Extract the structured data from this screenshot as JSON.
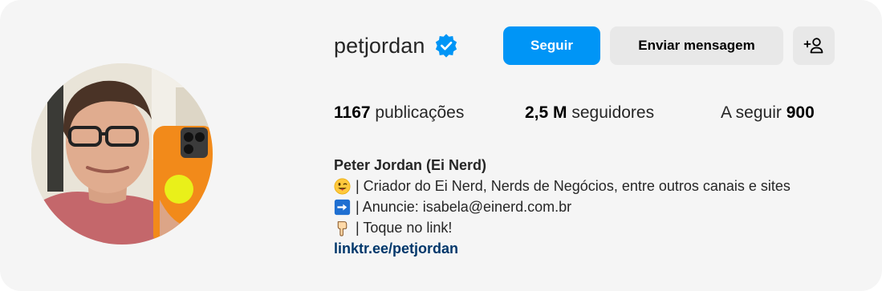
{
  "profile": {
    "username": "petjordan",
    "verified": true,
    "avatar_alt": "Peter Jordan selfie"
  },
  "actions": {
    "follow_label": "Seguir",
    "message_label": "Enviar mensagem",
    "suggest_icon": "person-plus-icon"
  },
  "stats": {
    "posts_count": "1167",
    "posts_label": "publicações",
    "followers_count": "2,5 M",
    "followers_label": "seguidores",
    "following_label": "A seguir",
    "following_count": "900"
  },
  "bio": {
    "name": "Peter Jordan (Ei Nerd)",
    "lines": [
      {
        "emoji": "winking-tongue-emoji",
        "text": "| Criador do Ei Nerd, Nerds de Negócios, entre outros canais e sites"
      },
      {
        "emoji": "right-arrow-emoji",
        "text": "| Anuncie: isabela@einerd.com.br"
      },
      {
        "emoji": "pointing-down-emoji",
        "text": "| Toque no link!"
      }
    ],
    "link": "linktr.ee/petjordan"
  },
  "colors": {
    "card_bg": "#f5f5f5",
    "follow_button": "#0095f6",
    "secondary_button": "#e8e8e8",
    "verified_badge": "#0095f6",
    "link": "#00376b"
  }
}
